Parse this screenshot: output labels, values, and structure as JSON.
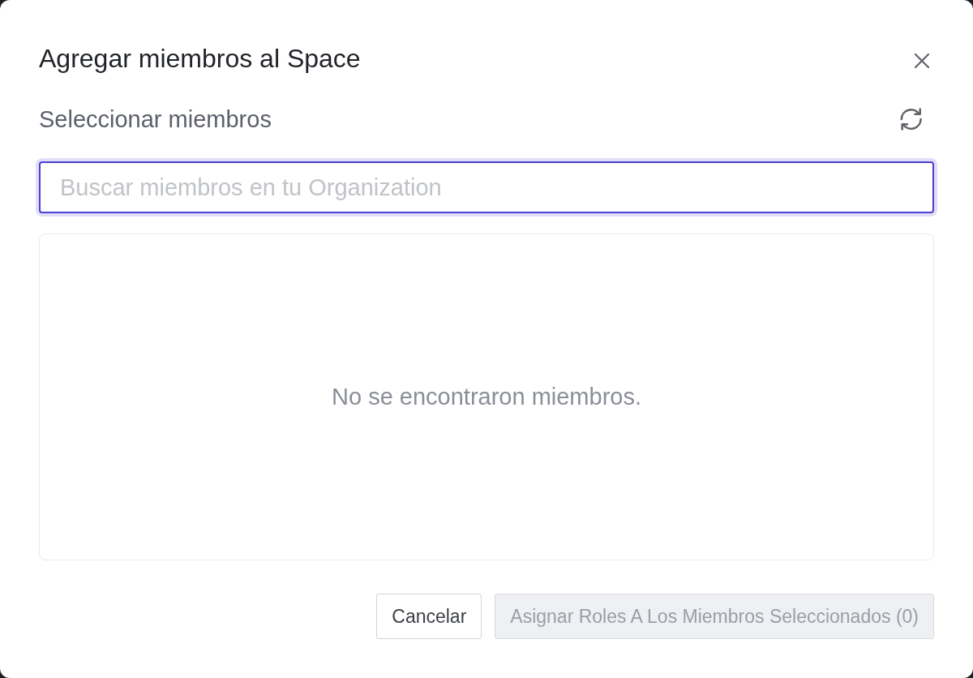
{
  "dialog": {
    "title": "Agregar miembros al Space"
  },
  "section": {
    "heading": "Seleccionar miembros"
  },
  "search": {
    "placeholder": "Buscar miembros en tu Organization",
    "focused": true
  },
  "results": {
    "empty_message": "No se encontraron miembros."
  },
  "buttons": [
    {
      "label": "Cancelar",
      "kind": "secondary",
      "disabled": false
    },
    {
      "label": "Asignar Roles A Los Miembros Seleccionados (0)",
      "kind": "primary",
      "disabled": true
    }
  ]
}
